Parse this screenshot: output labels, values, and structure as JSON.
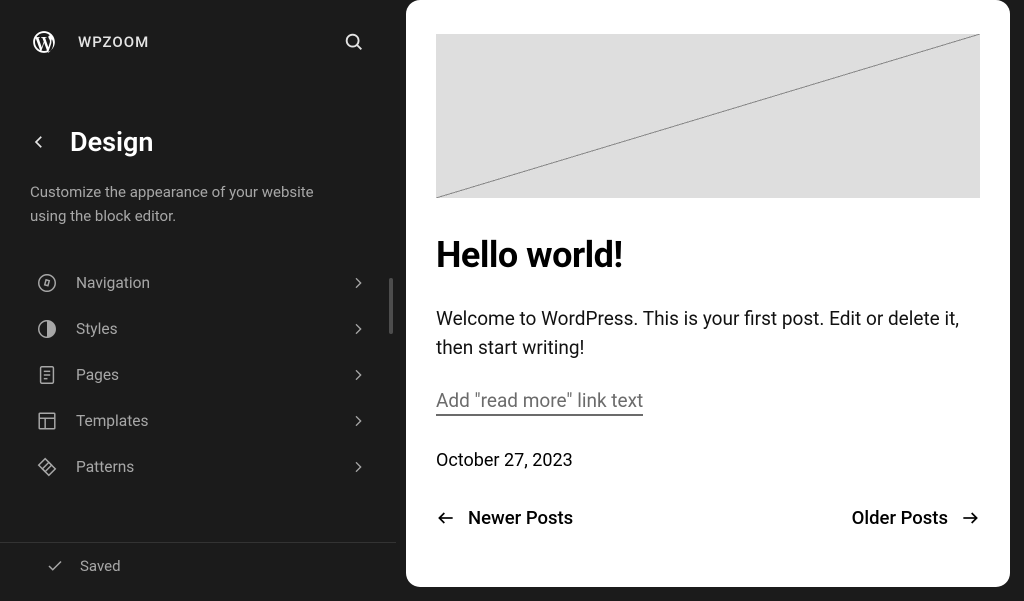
{
  "header": {
    "site_title": "WPZOOM"
  },
  "panel": {
    "title": "Design",
    "description": "Customize the appearance of your website using the block editor.",
    "items": [
      {
        "icon": "compass",
        "label": "Navigation"
      },
      {
        "icon": "contrast",
        "label": "Styles"
      },
      {
        "icon": "page",
        "label": "Pages"
      },
      {
        "icon": "layout",
        "label": "Templates"
      },
      {
        "icon": "pattern",
        "label": "Patterns"
      }
    ],
    "saved_label": "Saved"
  },
  "preview": {
    "post_title": "Hello world!",
    "excerpt": "Welcome to WordPress. This is your first post. Edit or delete it, then start writing!",
    "read_more_placeholder": "Add \"read more\" link text",
    "date": "October 27, 2023",
    "newer_label": "Newer Posts",
    "older_label": "Older Posts"
  }
}
